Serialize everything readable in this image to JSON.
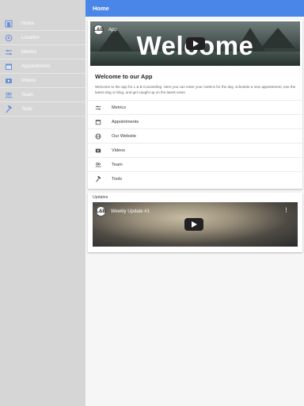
{
  "header": {
    "title": "Home",
    "color": "#4a86e8"
  },
  "sidebar": {
    "items": [
      {
        "label": "Home",
        "icon": "home-icon"
      },
      {
        "label": "Location",
        "icon": "location-icon"
      },
      {
        "label": "Metrics",
        "icon": "sliders-icon"
      },
      {
        "label": "Appointments",
        "icon": "calendar-icon"
      },
      {
        "label": "Videos",
        "icon": "video-icon"
      },
      {
        "label": "Team",
        "icon": "team-icon"
      },
      {
        "label": "Tools",
        "icon": "hammer-icon"
      }
    ]
  },
  "main": {
    "hero_video": {
      "channel": "L&B",
      "title": "App",
      "overlay_text": "Welcome"
    },
    "welcome": {
      "title": "Welcome to our App",
      "description": "Welcome to the app for L & B Counseling. Here you can enter your metrics for the day, schedule a new appointment, see the latest vlog or blog, and get caught up on the latest news."
    },
    "menu": [
      {
        "label": "Metrics",
        "icon": "sliders-icon"
      },
      {
        "label": "Appointments",
        "icon": "calendar-icon"
      },
      {
        "label": "Our Website",
        "icon": "globe-icon"
      },
      {
        "label": "Videos",
        "icon": "video-icon"
      },
      {
        "label": "Team",
        "icon": "team-icon"
      },
      {
        "label": "Tools",
        "icon": "hammer-icon"
      }
    ],
    "updates": {
      "label": "Updates",
      "video": {
        "channel": "L&B",
        "title": "Weekly Update #1"
      }
    }
  }
}
